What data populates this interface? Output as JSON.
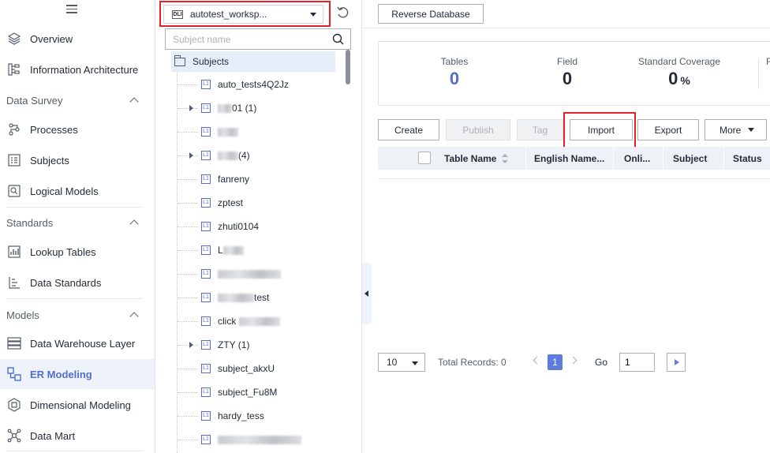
{
  "nav": {
    "items": [
      {
        "label": "Overview",
        "icon": "overview-icon"
      },
      {
        "label": "Information Architecture",
        "icon": "information-architecture-icon"
      },
      {
        "label": "Processes",
        "icon": "processes-icon"
      },
      {
        "label": "Subjects",
        "icon": "subjects-icon"
      },
      {
        "label": "Logical Models",
        "icon": "logical-models-icon"
      },
      {
        "label": "Lookup Tables",
        "icon": "lookup-tables-icon"
      },
      {
        "label": "Data Standards",
        "icon": "data-standards-icon"
      },
      {
        "label": "Data Warehouse Layer",
        "icon": "data-warehouse-layer-icon"
      },
      {
        "label": "ER Modeling",
        "icon": "er-modeling-icon",
        "active": true
      },
      {
        "label": "Dimensional Modeling",
        "icon": "dimensional-modeling-icon"
      },
      {
        "label": "Data Mart",
        "icon": "data-mart-icon"
      }
    ],
    "groups": [
      {
        "label": "Data Survey"
      },
      {
        "label": "Standards"
      },
      {
        "label": "Models"
      }
    ]
  },
  "tree": {
    "workspace": "autotest_worksp...",
    "search_placeholder": "Subject name",
    "root_label": "Subjects",
    "rows": [
      {
        "label": "auto_tests4Q2Jz"
      },
      {
        "label": "01 (1)"
      },
      {
        "label": ""
      },
      {
        "label": "(4)"
      },
      {
        "label": "fanreny"
      },
      {
        "label": "zptest"
      },
      {
        "label": "zhuti0104"
      },
      {
        "label": "L"
      },
      {
        "label": ""
      },
      {
        "label": "test"
      },
      {
        "label": "click"
      },
      {
        "label": "ZTY (1)"
      },
      {
        "label": "subject_akxU"
      },
      {
        "label": "subject_Fu8M"
      },
      {
        "label": "hardy_tess"
      },
      {
        "label": ""
      }
    ],
    "l1_badge": "L1",
    "db_badge": "DLI"
  },
  "main": {
    "reverse_db_label": "Reverse Database",
    "stats": {
      "tables_label": "Tables",
      "tables_value": "0",
      "field_label": "Field",
      "field_value": "0",
      "coverage_label": "Standard Coverage",
      "coverage_value": "0",
      "coverage_unit": "%",
      "fourth_label": "F"
    },
    "toolbar": {
      "create": "Create",
      "publish": "Publish",
      "tag": "Tag",
      "import": "Import",
      "export": "Export",
      "more": "More"
    },
    "table": {
      "columns": [
        "Table Name",
        "English Name...",
        "Onli...",
        "Subject",
        "Status"
      ]
    },
    "pager": {
      "page_size": "10",
      "total": "Total Records: 0",
      "current_page": "1",
      "go_label": "Go",
      "go_value": "1"
    }
  },
  "colors": {
    "accent": "#526ecc",
    "highlight_box": "#e0232b",
    "active_bg": "#eef3fb"
  }
}
